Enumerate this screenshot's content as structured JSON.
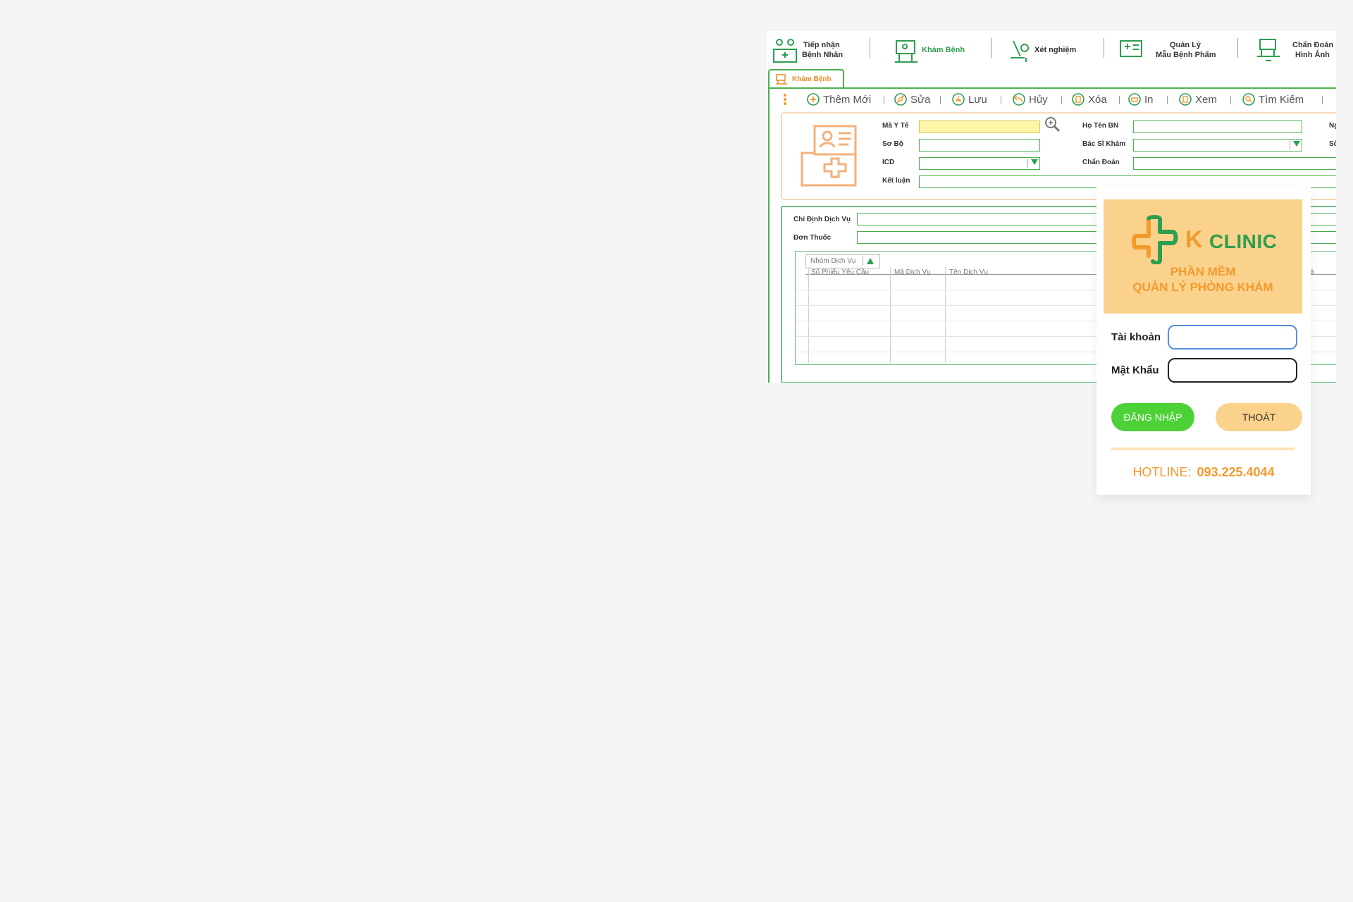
{
  "nav": {
    "items": [
      {
        "label_line1": "Tiếp nhận",
        "label_line2": "Bệnh Nhân",
        "icon": "reception-desk-icon"
      },
      {
        "label_line1": "Khám Bệnh",
        "label_line2": "",
        "icon": "examination-icon"
      },
      {
        "label_line1": "Xét nghiệm",
        "label_line2": "",
        "icon": "lab-test-icon"
      },
      {
        "label_line1": "Quản Lý",
        "label_line2": "Mẫu Bệnh Phẩm",
        "icon": "specimen-icon"
      },
      {
        "label_line1": "Chẩn Đoán",
        "label_line2": "Hình Ảnh",
        "icon": "imaging-icon"
      }
    ],
    "active": "Khám Bệnh"
  },
  "tab": {
    "label": "Khám Bệnh"
  },
  "toolbar": {
    "items": [
      {
        "label": "Thêm Mới",
        "icon": "add-icon"
      },
      {
        "label": "Sửa",
        "icon": "edit-icon"
      },
      {
        "label": "Lưu",
        "icon": "save-icon"
      },
      {
        "label": "Hủy",
        "icon": "undo-icon"
      },
      {
        "label": "Xóa",
        "icon": "delete-icon"
      },
      {
        "label": "In",
        "icon": "print-icon"
      },
      {
        "label": "Xem",
        "icon": "view-icon"
      },
      {
        "label": "Tìm Kiếm",
        "icon": "search-icon"
      }
    ]
  },
  "patient_form": {
    "ma_y_te": "Mã Y Tế",
    "so_bo": "Sơ Bộ",
    "icd": "ICD",
    "ket_luan": "Kết luận",
    "ho_ten": "Họ Tên BN",
    "bac_si": "Bác Sĩ Khám",
    "chan_doan": "Chẩn Đoán",
    "cut_1": "Ng",
    "cut_2": "Số"
  },
  "services": {
    "chi_dinh": "Chỉ Định Dịch Vụ",
    "don_thuoc": "Đơn Thuốc",
    "group_by": "Nhóm Dịch Vụ",
    "columns": [
      "Số Phiếu Yêu Cầu",
      "Mã Dịch Vụ",
      "Tên Dịch Vụ"
    ],
    "cut_col": "á"
  },
  "login": {
    "brand_k": "K",
    "brand_clinic": "CLINIC",
    "tagline_1": "PHẦN MỀM",
    "tagline_2": "QUẢN LÝ PHÒNG KHÁM",
    "username_label": "Tài khoản",
    "password_label": "Mật Khẩu",
    "username_value": "",
    "password_value": "",
    "login_button": "ĐĂNG NHẬP",
    "exit_button": "THOÁT",
    "hotline_label": "HOTLINE:",
    "hotline_number": "093.225.4044"
  },
  "colors": {
    "green": "#2e9e4f",
    "orange": "#f39a2c",
    "peach": "#fad28c",
    "login_green": "#4cd136"
  }
}
